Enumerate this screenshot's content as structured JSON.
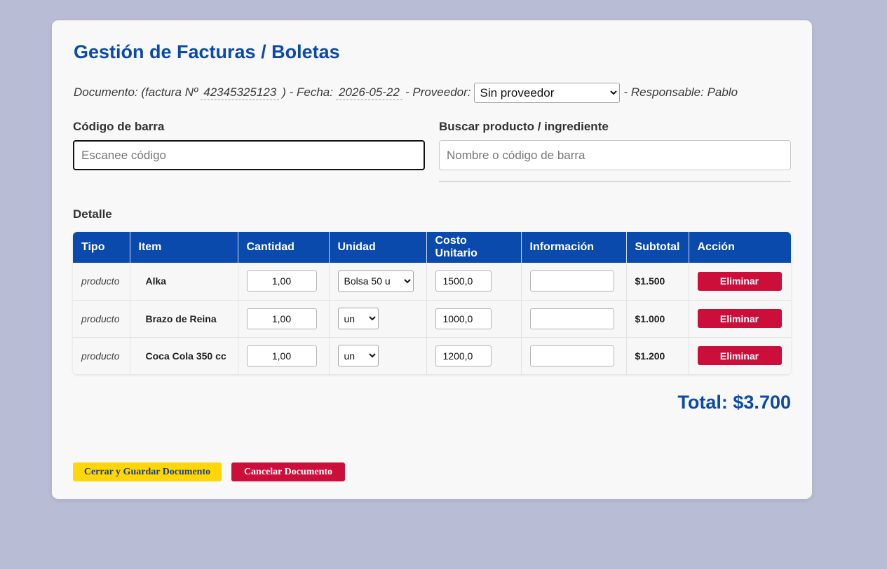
{
  "page": {
    "title": "Gestión de Facturas / Boletas"
  },
  "document": {
    "doc_prefix": "Documento: (factura Nº",
    "doc_number": "42345325123",
    "date_prefix": ") - Fecha:",
    "date": "2026-05-22",
    "provider_prefix": "- Proveedor:",
    "provider_selected": "Sin proveedor",
    "responsible": "- Responsable: Pablo"
  },
  "barcode": {
    "label": "Código de barra",
    "placeholder": "Escanee código"
  },
  "search": {
    "label": "Buscar producto / ingrediente",
    "placeholder": "Nombre o código de barra"
  },
  "detail": {
    "label": "Detalle",
    "headers": [
      "Tipo",
      "Item",
      "Cantidad",
      "Unidad",
      "Costo Unitario",
      "Información",
      "Subtotal",
      "Acción"
    ],
    "rows": [
      {
        "tipo": "producto",
        "item": "Alka",
        "cantidad": "1,00",
        "unidad": "Bolsa 50 u",
        "costo": "1500,0",
        "info": "",
        "subtotal": "$1.500",
        "accion": "Eliminar"
      },
      {
        "tipo": "producto",
        "item": "Brazo de Reina",
        "cantidad": "1,00",
        "unidad": "un",
        "costo": "1000,0",
        "info": "",
        "subtotal": "$1.000",
        "accion": "Eliminar"
      },
      {
        "tipo": "producto",
        "item": "Coca Cola 350 cc",
        "cantidad": "1,00",
        "unidad": "un",
        "costo": "1200,0",
        "info": "",
        "subtotal": "$1.200",
        "accion": "Eliminar"
      }
    ]
  },
  "total": {
    "label": "Total: $3.700"
  },
  "actions": {
    "save_label": "Cerrar y Guardar Documento",
    "cancel_label": "Cancelar Documento"
  },
  "colors": {
    "primary_blue": "#0b4aad",
    "danger_red": "#cc0e3a",
    "save_yellow": "#ffd60a",
    "background": "#b8bcd4"
  }
}
